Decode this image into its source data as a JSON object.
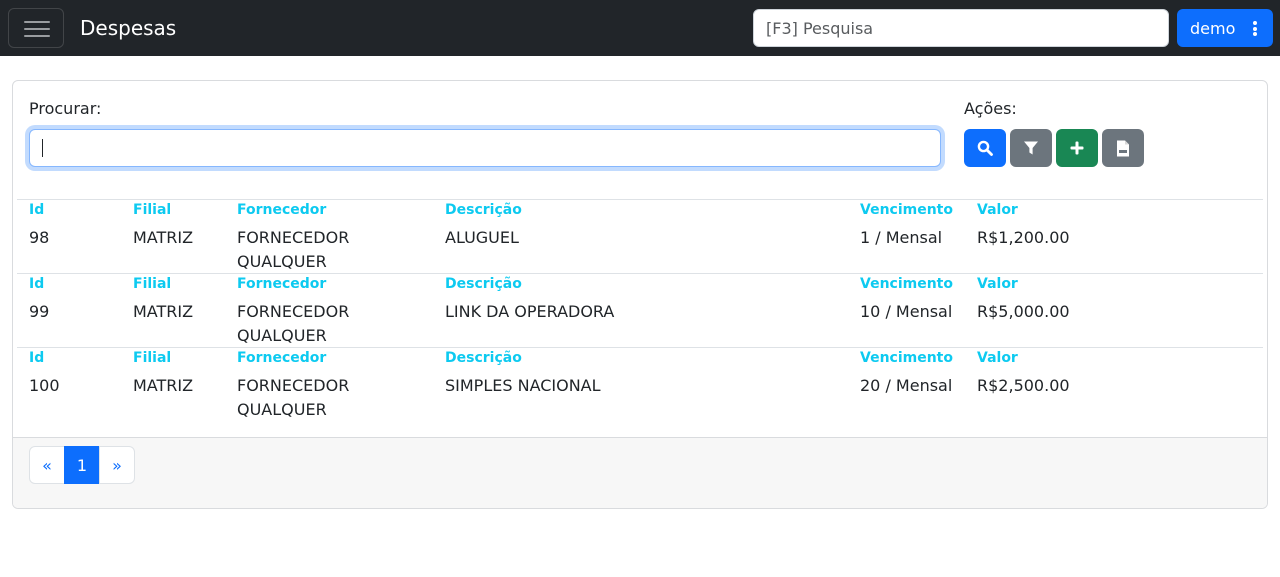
{
  "navbar": {
    "title": "Despesas",
    "search_placeholder": "[F3] Pesquisa",
    "user_label": "demo"
  },
  "filters": {
    "search_label": "Procurar:",
    "search_value": "",
    "actions_label": "Ações:",
    "action_icons": [
      "search-icon",
      "filter-icon",
      "plus-icon",
      "csv-file-icon"
    ]
  },
  "columns": [
    "Id",
    "Filial",
    "Fornecedor",
    "Descrição",
    "Vencimento",
    "Valor"
  ],
  "rows": [
    {
      "id": "98",
      "filial": "MATRIZ",
      "fornecedor": "FORNECEDOR QUALQUER",
      "descricao": "ALUGUEL",
      "vencimento": "1 / Mensal",
      "valor": "R$1,200.00"
    },
    {
      "id": "99",
      "filial": "MATRIZ",
      "fornecedor": "FORNECEDOR QUALQUER",
      "descricao": "LINK DA OPERADORA",
      "vencimento": "10 / Mensal",
      "valor": "R$5,000.00"
    },
    {
      "id": "100",
      "filial": "MATRIZ",
      "fornecedor": "FORNECEDOR QUALQUER",
      "descricao": "SIMPLES NACIONAL",
      "vencimento": "20 / Mensal",
      "valor": "R$2,500.00"
    }
  ],
  "pagination": {
    "prev": "«",
    "current": "1",
    "next": "»"
  },
  "colors": {
    "navbar": "#212529",
    "primary": "#0d6efd",
    "secondary": "#6c757d",
    "success": "#198754",
    "header_text": "#0dcaf0"
  }
}
